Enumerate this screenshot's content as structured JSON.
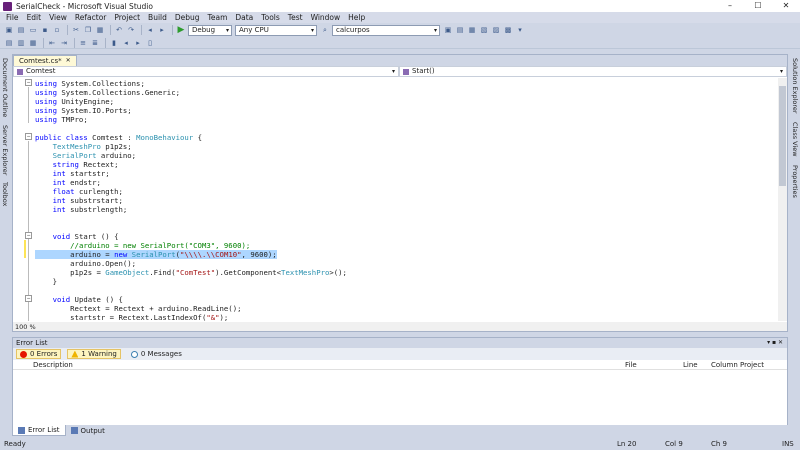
{
  "window": {
    "title": "SerialCheck - Microsoft Visual Studio"
  },
  "menu": [
    "File",
    "Edit",
    "View",
    "Refactor",
    "Project",
    "Build",
    "Debug",
    "Team",
    "Data",
    "Tools",
    "Test",
    "Window",
    "Help"
  ],
  "toolbar": {
    "config": "Debug",
    "platform": "Any CPU",
    "find": "calcurpos"
  },
  "editor": {
    "tab_label": "Comtest.cs*",
    "nav_left": "Comtest",
    "nav_right": "Start()",
    "zoom": "100 %",
    "lines": [
      "using System.Collections;",
      "using System.Collections.Generic;",
      "using UnityEngine;",
      "using System.IO.Ports;",
      "using TMPro;",
      "",
      "public class Comtest : MonoBehaviour {",
      "    TextMeshPro p1p2s;",
      "    SerialPort arduino;",
      "    string Rectext;",
      "    int startstr;",
      "    int endstr;",
      "    float curlength;",
      "    int substrstart;",
      "    int substrlength;",
      "",
      "",
      "    void Start () {",
      "        //arduino = new SerialPort(\"COM3\", 9600);",
      "        arduino = new SerialPort(\"\\\\\\\\.\\\\COM10\", 9600);",
      "        arduino.Open();",
      "        p1p2s = GameObject.Find(\"ComTest\").GetComponent<TextMeshPro>();",
      "    }",
      "",
      "    void Update () {",
      "        Rectext = Rectext + arduino.ReadLine();",
      "        startstr = Rectext.LastIndexOf(\"&\");"
    ]
  },
  "side_tabs_left": [
    "Document Outline",
    "Server Explorer",
    "Toolbox"
  ],
  "side_tabs_right": [
    "Solution Explorer",
    "Class View",
    "Properties"
  ],
  "error_list": {
    "title": "Error List",
    "errors": "0 Errors",
    "warnings": "1 Warning",
    "messages": "0 Messages",
    "columns": [
      "Description",
      "File",
      "Line",
      "Column",
      "Project"
    ]
  },
  "bottom_tabs": [
    "Error List",
    "Output"
  ],
  "status": {
    "state": "Ready",
    "line": "Ln 20",
    "col": "Col 9",
    "ch": "Ch 9",
    "mode": "INS"
  }
}
